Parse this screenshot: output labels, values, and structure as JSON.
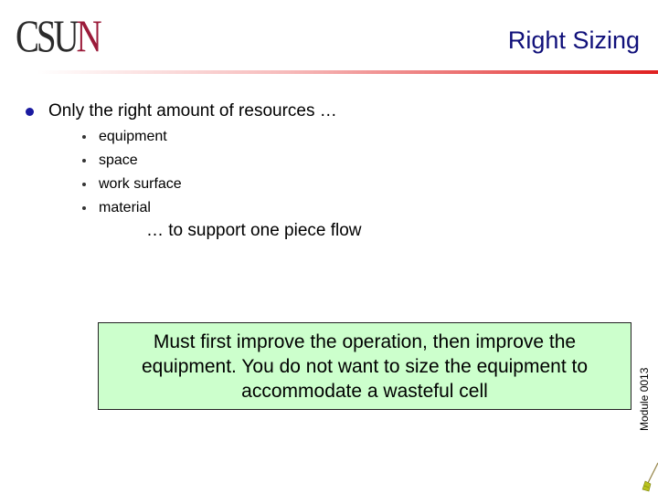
{
  "header": {
    "logo": {
      "main": "CSU",
      "accent": "N"
    },
    "title": "Right Sizing"
  },
  "content": {
    "main_bullet": "Only the right amount of resources …",
    "sub_items": [
      "equipment",
      "space",
      "work surface",
      "material"
    ],
    "tagline": "… to support one piece flow"
  },
  "callout": {
    "text": "Must first improve the operation, then improve the equipment. You do not want to size the equipment to accommodate a wasteful cell",
    "background_color": "#ccffcc"
  },
  "footer": {
    "module_label": "Module 0013",
    "icon": "broom-icon"
  },
  "colors": {
    "title": "#10107a",
    "logo_accent": "#9b1b3a",
    "bullet": "#1a1aa0",
    "rule_end": "#e02020"
  }
}
